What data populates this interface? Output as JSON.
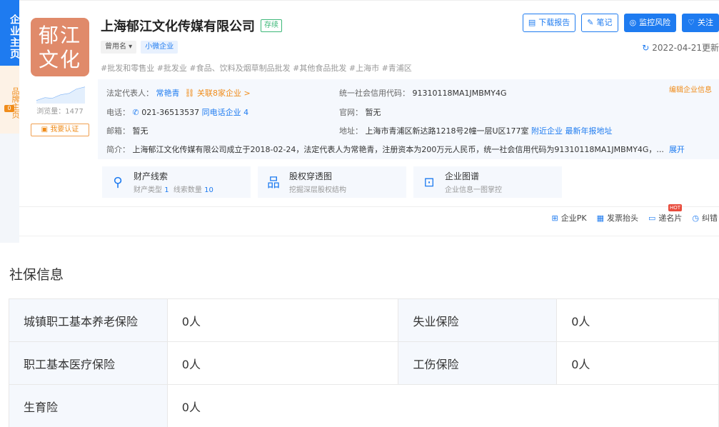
{
  "sidebar": {
    "main_tab": "企业主页",
    "brand_tab": "品牌主页",
    "brand_count": "0"
  },
  "company": {
    "logo_text": "郁江文化",
    "name": "上海郁江文化传媒有限公司",
    "status": "存续",
    "views_label": "浏览量：1477",
    "claim_label": "我要认证",
    "former_name_label": "曾用名",
    "size_tag": "小微企业",
    "industry_tags": "#批发和零售业  #批发业  #食品、饮料及烟草制品批发  #其他食品批发  #上海市  #青浦区",
    "update": "2022-04-21更新"
  },
  "actions": {
    "download_report": "下载报告",
    "notes": "笔记",
    "monitor_risk": "监控风险",
    "follow": "关注"
  },
  "info": {
    "edit_label": "编辑企业信息",
    "legal_rep_key": "法定代表人：",
    "legal_rep": "常艳青",
    "related": "关联8家企业 >",
    "credit_code_key": "统一社会信用代码：",
    "credit_code": "91310118MA1JMBMY4G",
    "phone_key": "电话：",
    "phone": "021-36513537",
    "same_phone": "同电话企业 4",
    "website_key": "官网：",
    "website": "暂无",
    "email_key": "邮箱：",
    "email": "暂无",
    "address_key": "地址：",
    "address": "上海市青浦区新达路1218号2幢一层U区177室",
    "nearby": "附近企业",
    "latest_annual": "最新年报地址",
    "intro_key": "简介：",
    "intro": "上海郁江文化传媒有限公司成立于2018-02-24，法定代表人为常艳青，注册资本为200万元人民币，统一社会信用代码为91310118MA1JMBMY4G，...",
    "expand": "展开"
  },
  "features": [
    {
      "title": "财产线索",
      "sub_a": "财产类型",
      "sub_a_val": "1",
      "sub_b": "线索数量",
      "sub_b_val": "10"
    },
    {
      "title": "股权穿透图",
      "sub": "挖掘深层股权结构"
    },
    {
      "title": "企业图谱",
      "sub": "企业信息一图掌控"
    }
  ],
  "toolbar": {
    "pk": "企业PK",
    "invoice": "发票抬头",
    "card": "递名片",
    "hot": "HOT",
    "correct": "纠错"
  },
  "social_insurance": {
    "title": "社保信息",
    "rows": [
      {
        "l1": "城镇职工基本养老保险",
        "v1": "0人",
        "l2": "失业保险",
        "v2": "0人"
      },
      {
        "l1": "职工基本医疗保险",
        "v1": "0人",
        "l2": "工伤保险",
        "v2": "0人"
      },
      {
        "l1": "生育险",
        "v1": "0人",
        "l2": "",
        "v2": ""
      }
    ]
  }
}
